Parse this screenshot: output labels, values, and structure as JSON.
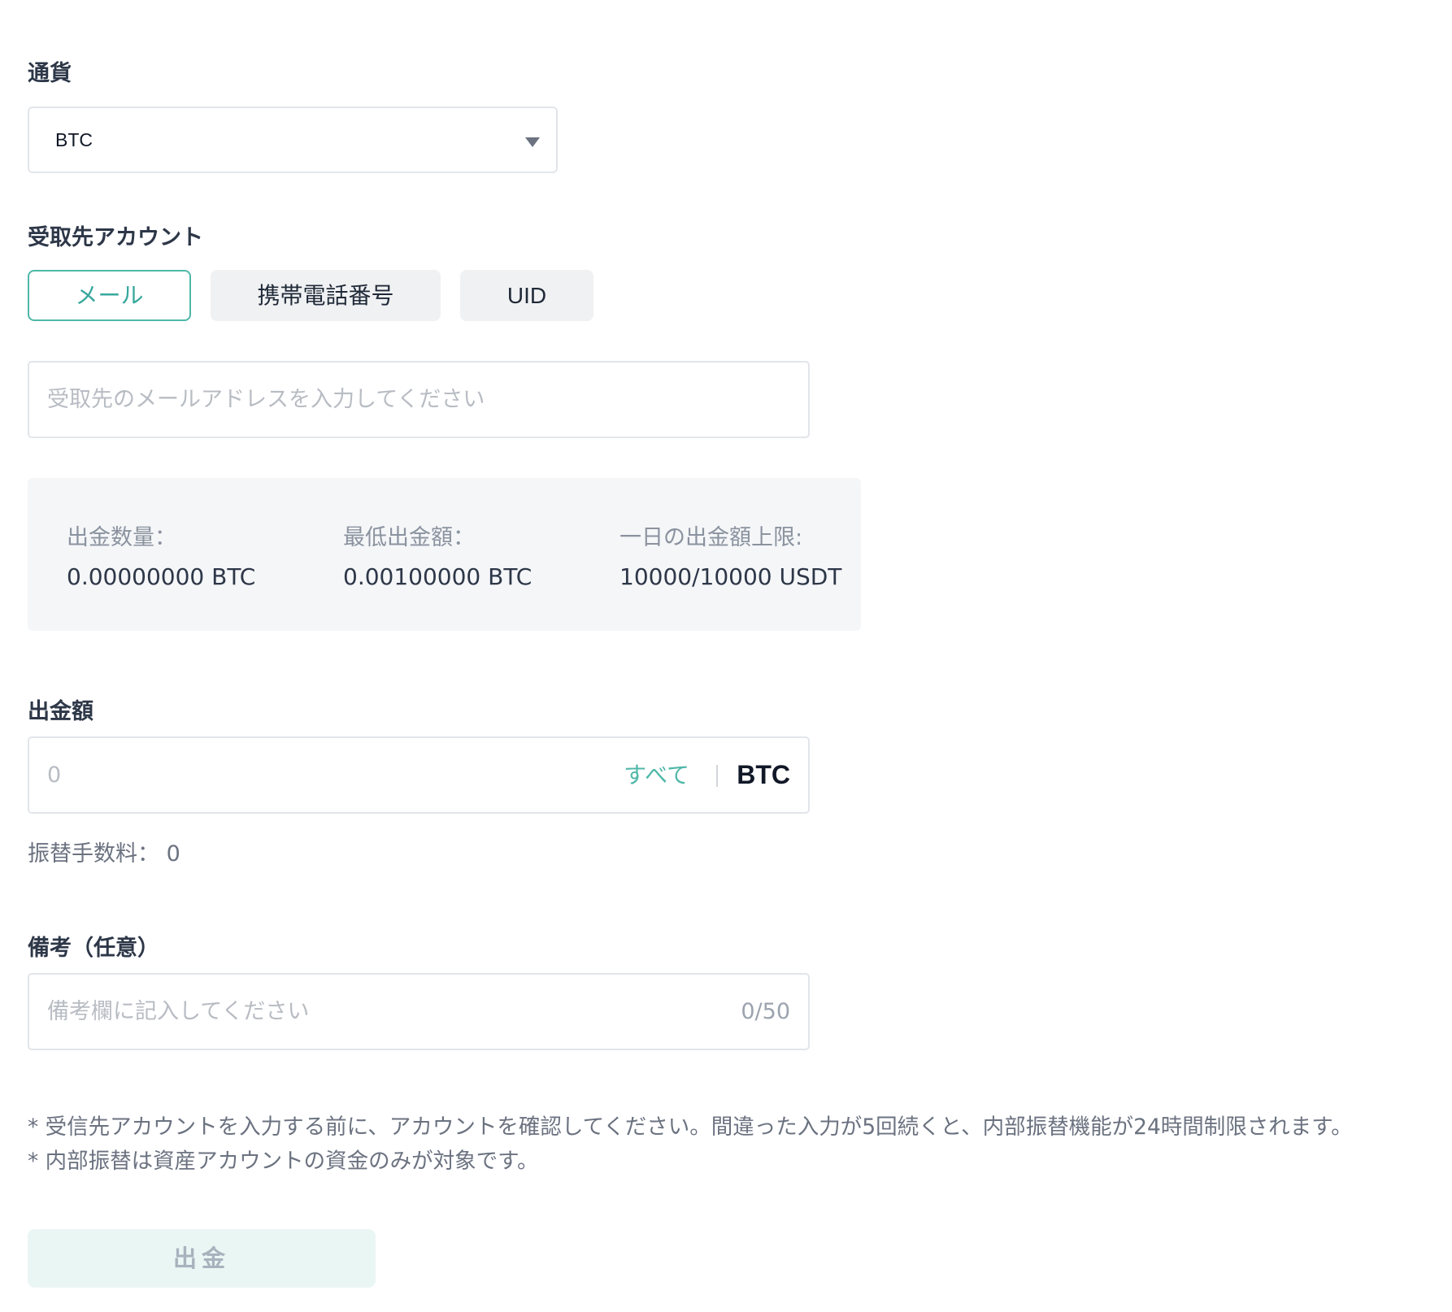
{
  "currency": {
    "label": "通貨",
    "selected": "BTC"
  },
  "recipient": {
    "label": "受取先アカウント",
    "tabs": [
      {
        "label": "メール",
        "active": true
      },
      {
        "label": "携帯電話番号",
        "active": false
      },
      {
        "label": "UID",
        "active": false
      }
    ],
    "placeholder": "受取先のメールアドレスを入力してください"
  },
  "info": {
    "withdraw_qty_label": "出金数量：",
    "withdraw_qty_value": "0.00000000 BTC",
    "min_label": "最低出金額：",
    "min_value": "0.00100000 BTC",
    "daily_limit_label": "一日の出金額上限:",
    "daily_limit_value": "10000/10000 USDT"
  },
  "amount": {
    "label": "出金額",
    "placeholder": "0",
    "all_label": "すべて",
    "unit": "BTC",
    "fee_text": "振替手数料： 0"
  },
  "memo": {
    "label": "備考（任意）",
    "placeholder": "備考欄に記入してください",
    "counter": "0/50"
  },
  "notes": [
    "* 受信先アカウントを入力する前に、アカウントを確認してください。間違った入力が5回続くと、内部振替機能が24時間制限されます。",
    "* 内部振替は資産アカウントの資金のみが対象です。"
  ],
  "submit_label": "出金",
  "colors": {
    "accent": "#4fb8a8",
    "submit_bg": "#eaf6f4",
    "panel_bg": "#f5f6f8"
  }
}
